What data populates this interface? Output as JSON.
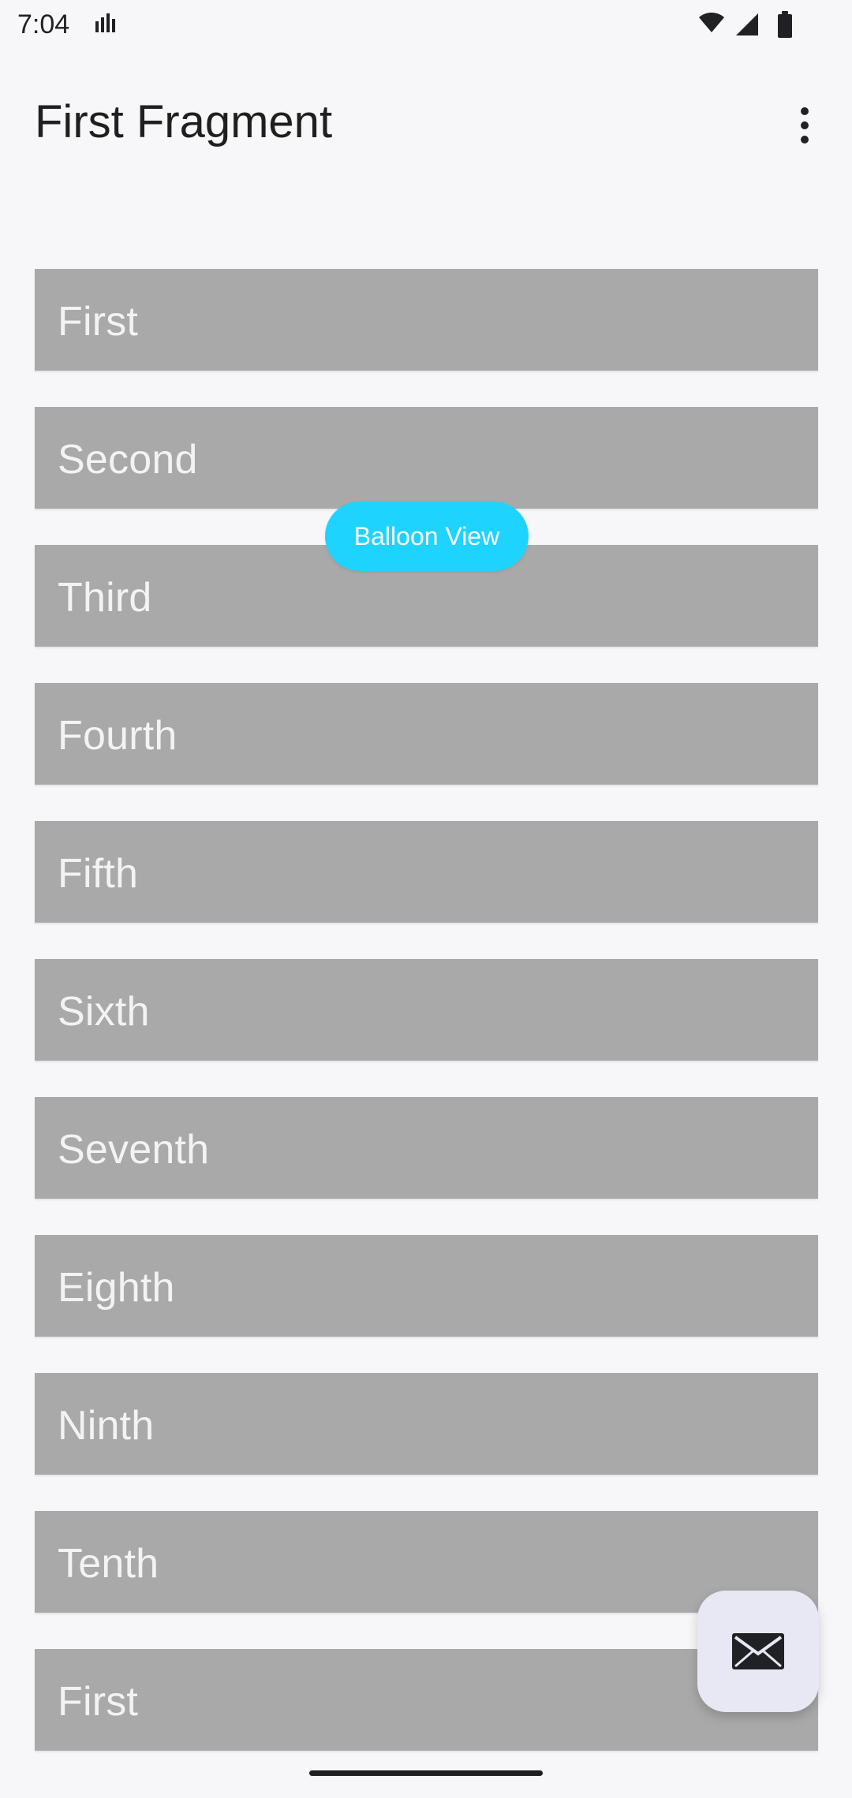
{
  "status_bar": {
    "time": "7:04",
    "left_icon": "signal-bars-icon",
    "right_icons": [
      "wifi-icon",
      "cell-signal-icon",
      "battery-icon"
    ]
  },
  "app_bar": {
    "title": "First Fragment",
    "menu_icon": "more-vert-icon"
  },
  "list": {
    "items": [
      {
        "label": "First"
      },
      {
        "label": "Second"
      },
      {
        "label": "Third"
      },
      {
        "label": "Fourth"
      },
      {
        "label": "Fifth"
      },
      {
        "label": "Sixth"
      },
      {
        "label": "Seventh"
      },
      {
        "label": "Eighth"
      },
      {
        "label": "Ninth"
      },
      {
        "label": "Tenth"
      },
      {
        "label": "First"
      }
    ]
  },
  "balloon": {
    "text": "Balloon View",
    "color": "#1fd3ff"
  },
  "fab": {
    "icon": "mail-icon",
    "background": "#e8e8f4"
  },
  "colors": {
    "background": "#f7f7f9",
    "list_item": "#a9a9a9",
    "list_text": "#f3f3f3",
    "title_text": "#1f1f1f"
  }
}
